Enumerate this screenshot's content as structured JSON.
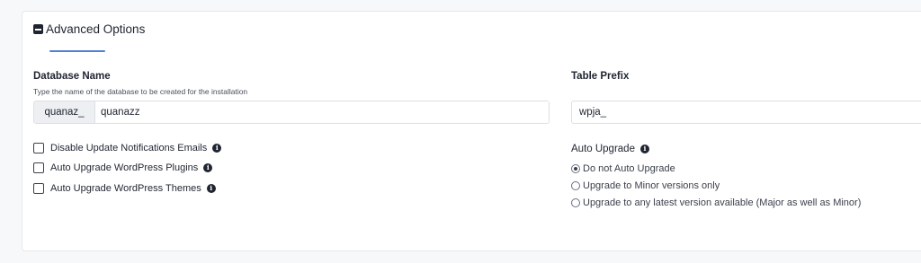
{
  "advanced_options": {
    "title": "Advanced Options",
    "icon": "minus-square-icon"
  },
  "database_name": {
    "label": "Database Name",
    "hint": "Type the name of the database to be created for the installation",
    "prefix": "quanaz_",
    "value": "quanazz"
  },
  "table_prefix": {
    "label": "Table Prefix",
    "value": "wpja_"
  },
  "checkboxes": [
    {
      "label": "Disable Update Notifications Emails",
      "checked": false
    },
    {
      "label": "Auto Upgrade WordPress Plugins",
      "checked": false
    },
    {
      "label": "Auto Upgrade WordPress Themes",
      "checked": false
    }
  ],
  "auto_upgrade": {
    "label": "Auto Upgrade",
    "options": [
      {
        "label": "Do not Auto Upgrade",
        "selected": true
      },
      {
        "label": "Upgrade to Minor versions only",
        "selected": false
      },
      {
        "label": "Upgrade to any latest version available (Major as well as Minor)",
        "selected": false
      }
    ]
  },
  "colors": {
    "accent_underline": "#4f7fd6",
    "text": "#1f2430",
    "border": "#dcdfe4"
  }
}
